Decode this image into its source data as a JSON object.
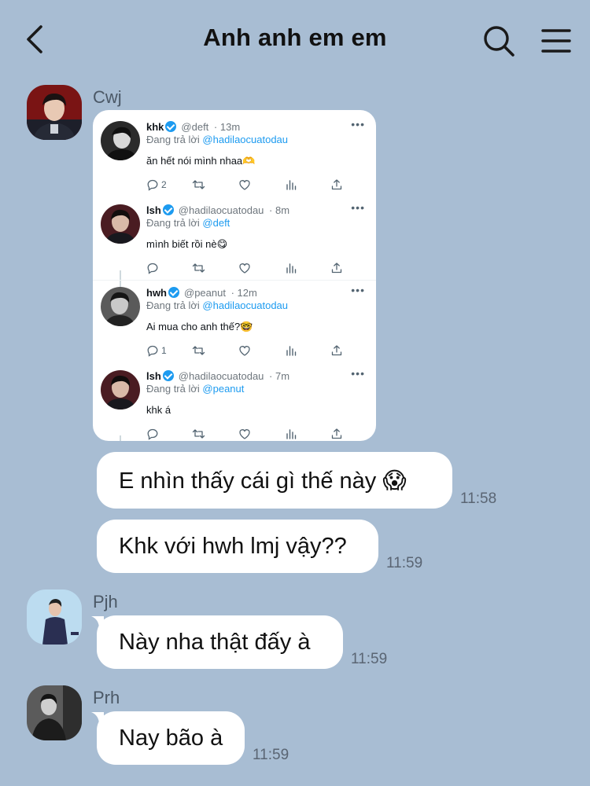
{
  "header": {
    "title": "Anh anh em em",
    "back_icon": "chevron-left-icon",
    "search_icon": "search-icon",
    "menu_icon": "hamburger-menu-icon"
  },
  "colors": {
    "background": "#a8bdd3",
    "bubble": "#ffffff",
    "twitter_blue": "#1d9bf0"
  },
  "messages": [
    {
      "sender": "Cwj",
      "attachment": {
        "type": "tweet-thread-screenshot",
        "tweets": [
          {
            "name": "khk",
            "handle": "@deft",
            "time": "· 13m",
            "reply_prefix": "Đang trả lời",
            "reply_to": "@hadilaocuatodau",
            "text": "ăn hết nói mình nhaa🫶",
            "reply_count": "2"
          },
          {
            "name": "lsh",
            "handle": "@hadilaocuatodau",
            "time": "· 8m",
            "reply_prefix": "Đang trả lời",
            "reply_to": "@deft",
            "text": "mình biết rồi nè😋",
            "reply_count": ""
          },
          {
            "name": "hwh",
            "handle": "@peanut",
            "time": "· 12m",
            "reply_prefix": "Đang trả lời",
            "reply_to": "@hadilaocuatodau",
            "text": "Ai mua cho anh thế?🤓",
            "reply_count": "1"
          },
          {
            "name": "lsh",
            "handle": "@hadilaocuatodau",
            "time": "· 7m",
            "reply_prefix": "Đang trả lời",
            "reply_to": "@peanut",
            "text": "khk á",
            "reply_count": ""
          }
        ]
      },
      "bubbles": [
        {
          "text": "E nhìn thấy cái gì thế này 😱",
          "time": "11:58"
        },
        {
          "text": "Khk với hwh lmj vậy??",
          "time": "11:59"
        }
      ]
    },
    {
      "sender": "Pjh",
      "bubbles": [
        {
          "text": "Này nha thật đấy à",
          "time": "11:59"
        }
      ]
    },
    {
      "sender": "Prh",
      "bubbles": [
        {
          "text": "Nay bão à",
          "time": "11:59"
        }
      ]
    }
  ]
}
